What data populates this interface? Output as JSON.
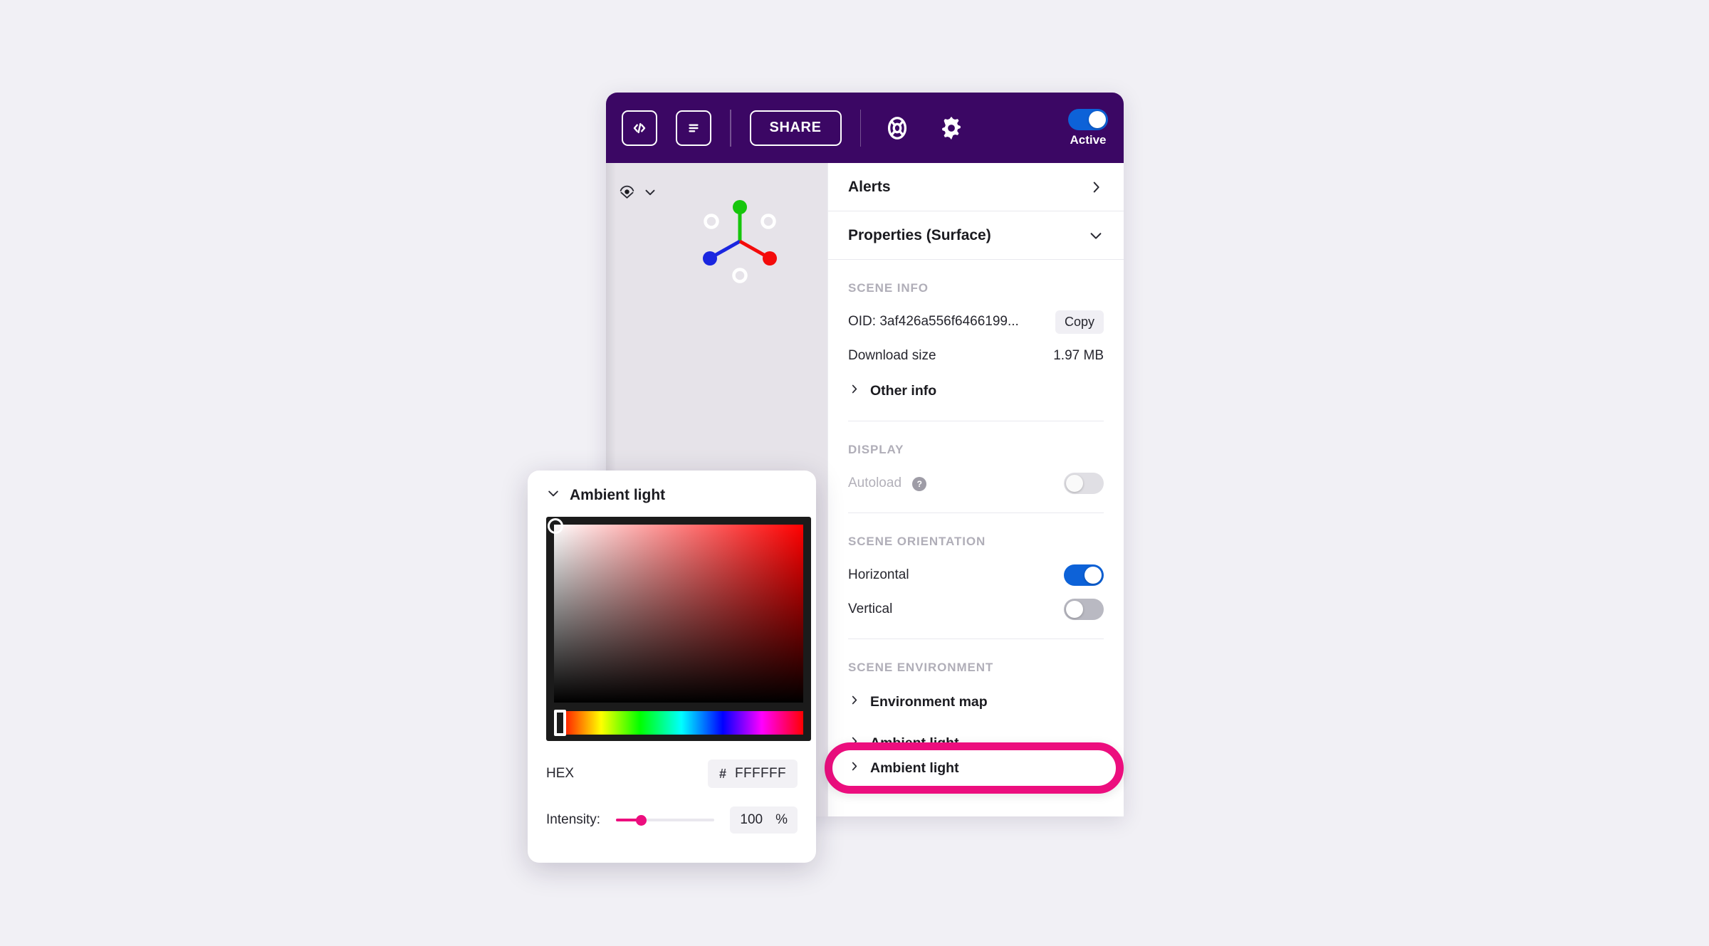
{
  "toolbar": {
    "code_icon": "code-brackets-icon",
    "doc_icon": "document-icon",
    "share_label": "SHARE",
    "help_icon": "lifebuoy-icon",
    "settings_icon": "gear-icon",
    "active_label": "Active",
    "active_on": true,
    "bar_color": "#3B0764",
    "toggle_on_color": "#0D62D8"
  },
  "viewport": {
    "view_icon": "eye-view-icon",
    "chevron_icon": "chevron-down-icon",
    "gizmo": {
      "axis_up_color": "#16C60C",
      "axis_left_color": "#1A26E0",
      "axis_right_color": "#F40B0B"
    }
  },
  "panel": {
    "alerts": {
      "title": "Alerts",
      "chevron": "chevron-right-icon"
    },
    "properties": {
      "title": "Properties (Surface)",
      "chevron": "chevron-down-icon"
    },
    "scene_info": {
      "label": "SCENE INFO",
      "oid_label": "OID: 3af426a556f6466199...",
      "copy_label": "Copy",
      "download_label": "Download size",
      "download_value": "1.97 MB",
      "other_info_label": "Other info"
    },
    "display": {
      "label": "DISPLAY",
      "autoload_label": "Autoload",
      "autoload_help": "?",
      "autoload_on": false
    },
    "scene_orientation": {
      "label": "SCENE ORIENTATION",
      "horizontal_label": "Horizontal",
      "horizontal_on": true,
      "vertical_label": "Vertical",
      "vertical_on": false
    },
    "scene_environment": {
      "label": "SCENE ENVIRONMENT",
      "environment_map_label": "Environment map",
      "ambient_light_label": "Ambient light"
    }
  },
  "highlight": {
    "label": "Ambient light",
    "ring_color": "#EC0E7E"
  },
  "color_picker": {
    "title": "Ambient light",
    "chevron": "chevron-down-icon",
    "selected_hue_deg": 0,
    "hex_label": "HEX",
    "hex_hash": "#",
    "hex_value": "FFFFFF",
    "intensity_label": "Intensity:",
    "intensity_value": "100",
    "intensity_unit": "%",
    "intensity_percent": 25,
    "accent_color": "#EC0E7E"
  }
}
